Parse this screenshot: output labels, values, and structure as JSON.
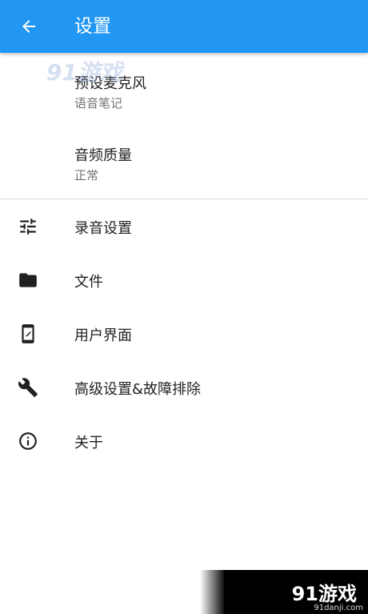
{
  "appbar": {
    "title": "设置",
    "back_icon": "arrow-back-icon",
    "color": "#2196f3"
  },
  "watermark_top": "91游戏",
  "preferences": [
    {
      "title": "预设麦克风",
      "summary": "语音笔记"
    },
    {
      "title": "音频质量",
      "summary": "正常"
    }
  ],
  "menu": [
    {
      "label": "录音设置",
      "icon": "tune-icon"
    },
    {
      "label": "文件",
      "icon": "folder-icon"
    },
    {
      "label": "用户界面",
      "icon": "phone-icon"
    },
    {
      "label": "高级设置&故障排除",
      "icon": "wrench-icon"
    },
    {
      "label": "关于",
      "icon": "info-icon"
    }
  ],
  "watermark_badge": {
    "text": "91游戏",
    "url": "91danji.com"
  }
}
